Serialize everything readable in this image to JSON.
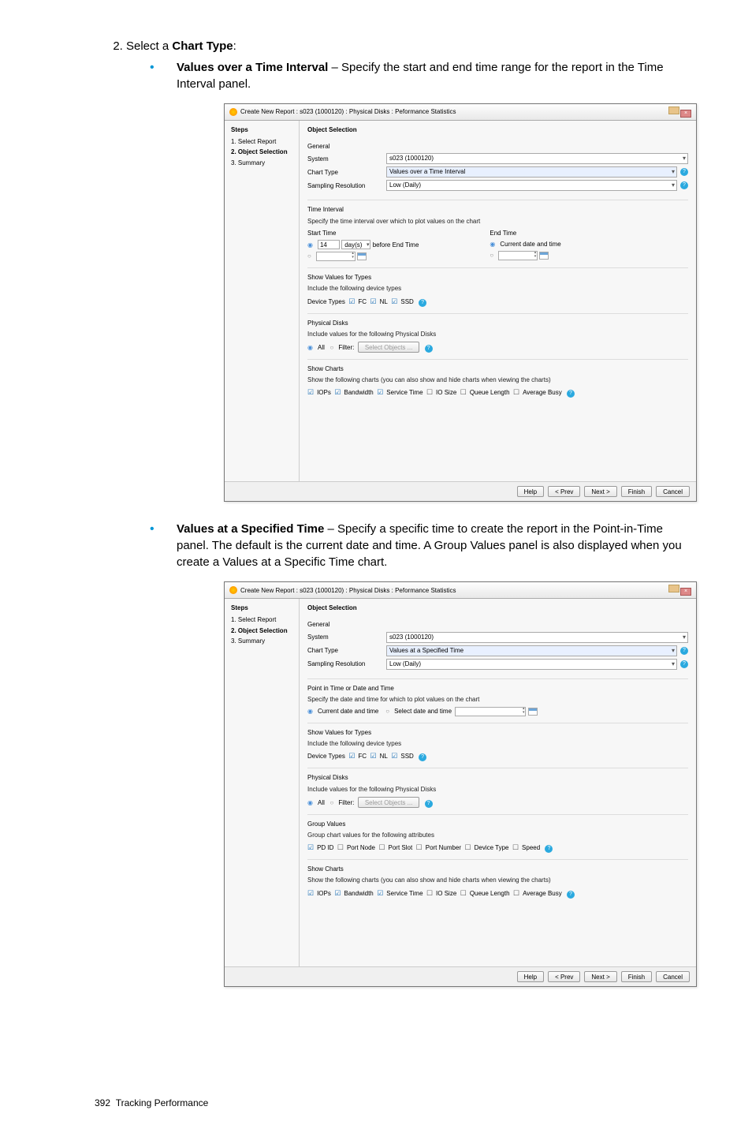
{
  "step2": {
    "number": "2.",
    "text_prefix": "Select a ",
    "bold": "Chart Type",
    "suffix": ":"
  },
  "bullet1": {
    "lead": "Values over a Time Interval",
    "rest": " – Specify the start and end time range for the report in the Time Interval panel."
  },
  "bullet2": {
    "lead": "Values at a Specified Time",
    "rest": " – Specify a specific time to create the report in the Point-in-Time panel. The default is the current date and time. A Group Values panel is also displayed when you create a Values at a Specific Time chart."
  },
  "dlg": {
    "title": "Create New Report : s023 (1000120) : Physical Disks : Peformance Statistics",
    "steps_hdr": "Steps",
    "step1": "1. Select Report",
    "step2": "2. Object Selection",
    "step3": "3. Summary",
    "section_title": "Object Selection",
    "general": "General",
    "system_lbl": "System",
    "system_val": "s023 (1000120)",
    "chart_type_lbl": "Chart Type",
    "chart_type_val1": "Values over a Time Interval",
    "chart_type_val2": "Values at a Specified Time",
    "sampling_lbl": "Sampling Resolution",
    "sampling_val": "Low (Daily)",
    "time_interval_hdr": "Time Interval",
    "time_interval_desc": "Specify the time interval over which to plot values on the chart",
    "start_time": "Start Time",
    "end_time": "End Time",
    "number_val": "14",
    "days": "day(s)",
    "before_end": "before End Time",
    "current_dt": "Current date and time",
    "pit_hdr": "Point in Time or Date and Time",
    "pit_desc": "Specify the date and time for which to plot values on the chart",
    "pit_opt1": "Current date and time",
    "pit_opt2": "Select date and time",
    "svt_hdr": "Show Values for Types",
    "svt_desc": "Include the following device types",
    "svt_lbl": "Device Types",
    "svt_fc": "FC",
    "svt_nl": "NL",
    "svt_ssd": "SSD",
    "pd_hdr": "Physical Disks",
    "pd_desc": "Include values for the following Physical Disks",
    "pd_all": "All",
    "pd_filter": "Filter:",
    "pd_select": "Select Objects ...",
    "gv_hdr": "Group Values",
    "gv_desc": "Group chart values for the following attributes",
    "gv_pdid": "PD ID",
    "gv_portnode": "Port Node",
    "gv_portslot": "Port Slot",
    "gv_portnum": "Port Number",
    "gv_devtype": "Device Type",
    "gv_speed": "Speed",
    "sc_hdr": "Show Charts",
    "sc_desc": "Show the following charts (you can also show and hide charts when viewing the charts)",
    "sc_iops": "IOPs",
    "sc_bw": "Bandwidth",
    "sc_st": "Service Time",
    "sc_io": "IO Size",
    "sc_ql": "Queue Length",
    "sc_ab": "Average Busy",
    "help": "Help",
    "prev": "< Prev",
    "next": "Next >",
    "finish": "Finish",
    "cancel": "Cancel"
  },
  "footer": {
    "page": "392",
    "label": "Tracking Performance"
  }
}
